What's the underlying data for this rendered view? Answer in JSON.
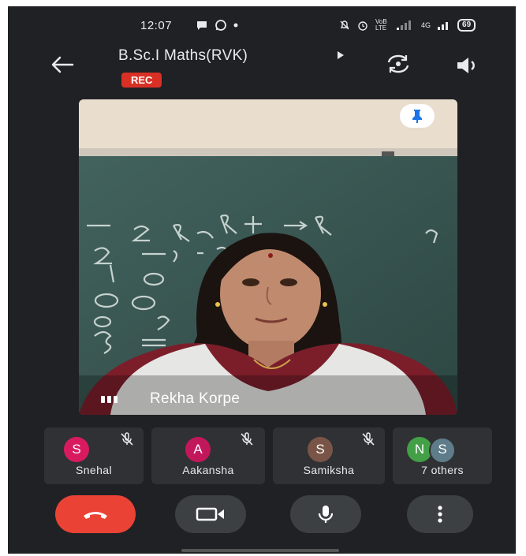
{
  "status_bar": {
    "time": "12:07",
    "battery": "69",
    "network_label": "VoB LTE",
    "signal_label": "4G"
  },
  "header": {
    "title": "B.Sc.I Maths(RVK)",
    "rec_label": "REC"
  },
  "main_video": {
    "participant_name": "Rekha Korpe",
    "board_text": "R₁ → R₁ + R₂ , R₂ − 1 0 − 1 2 0 1 0 0 0 0 3 ="
  },
  "participants": [
    {
      "initial": "S",
      "name": "Snehal",
      "color": "#d81b60",
      "muted": true
    },
    {
      "initial": "A",
      "name": "Aakansha",
      "color": "#c2185b",
      "muted": true
    },
    {
      "initial": "S",
      "name": "Samiksha",
      "color": "#795548",
      "muted": true
    },
    {
      "initials": [
        "N",
        "S"
      ],
      "name": "7 others",
      "colors": [
        "#43a047",
        "#5f7c8a"
      ]
    }
  ],
  "controls": {
    "end_call": "end-call",
    "camera": "camera",
    "mic": "mic",
    "more": "more-options"
  },
  "colors": {
    "background": "#202124",
    "rec": "#d93025",
    "end_call": "#ea4335",
    "tile": "#303134"
  }
}
